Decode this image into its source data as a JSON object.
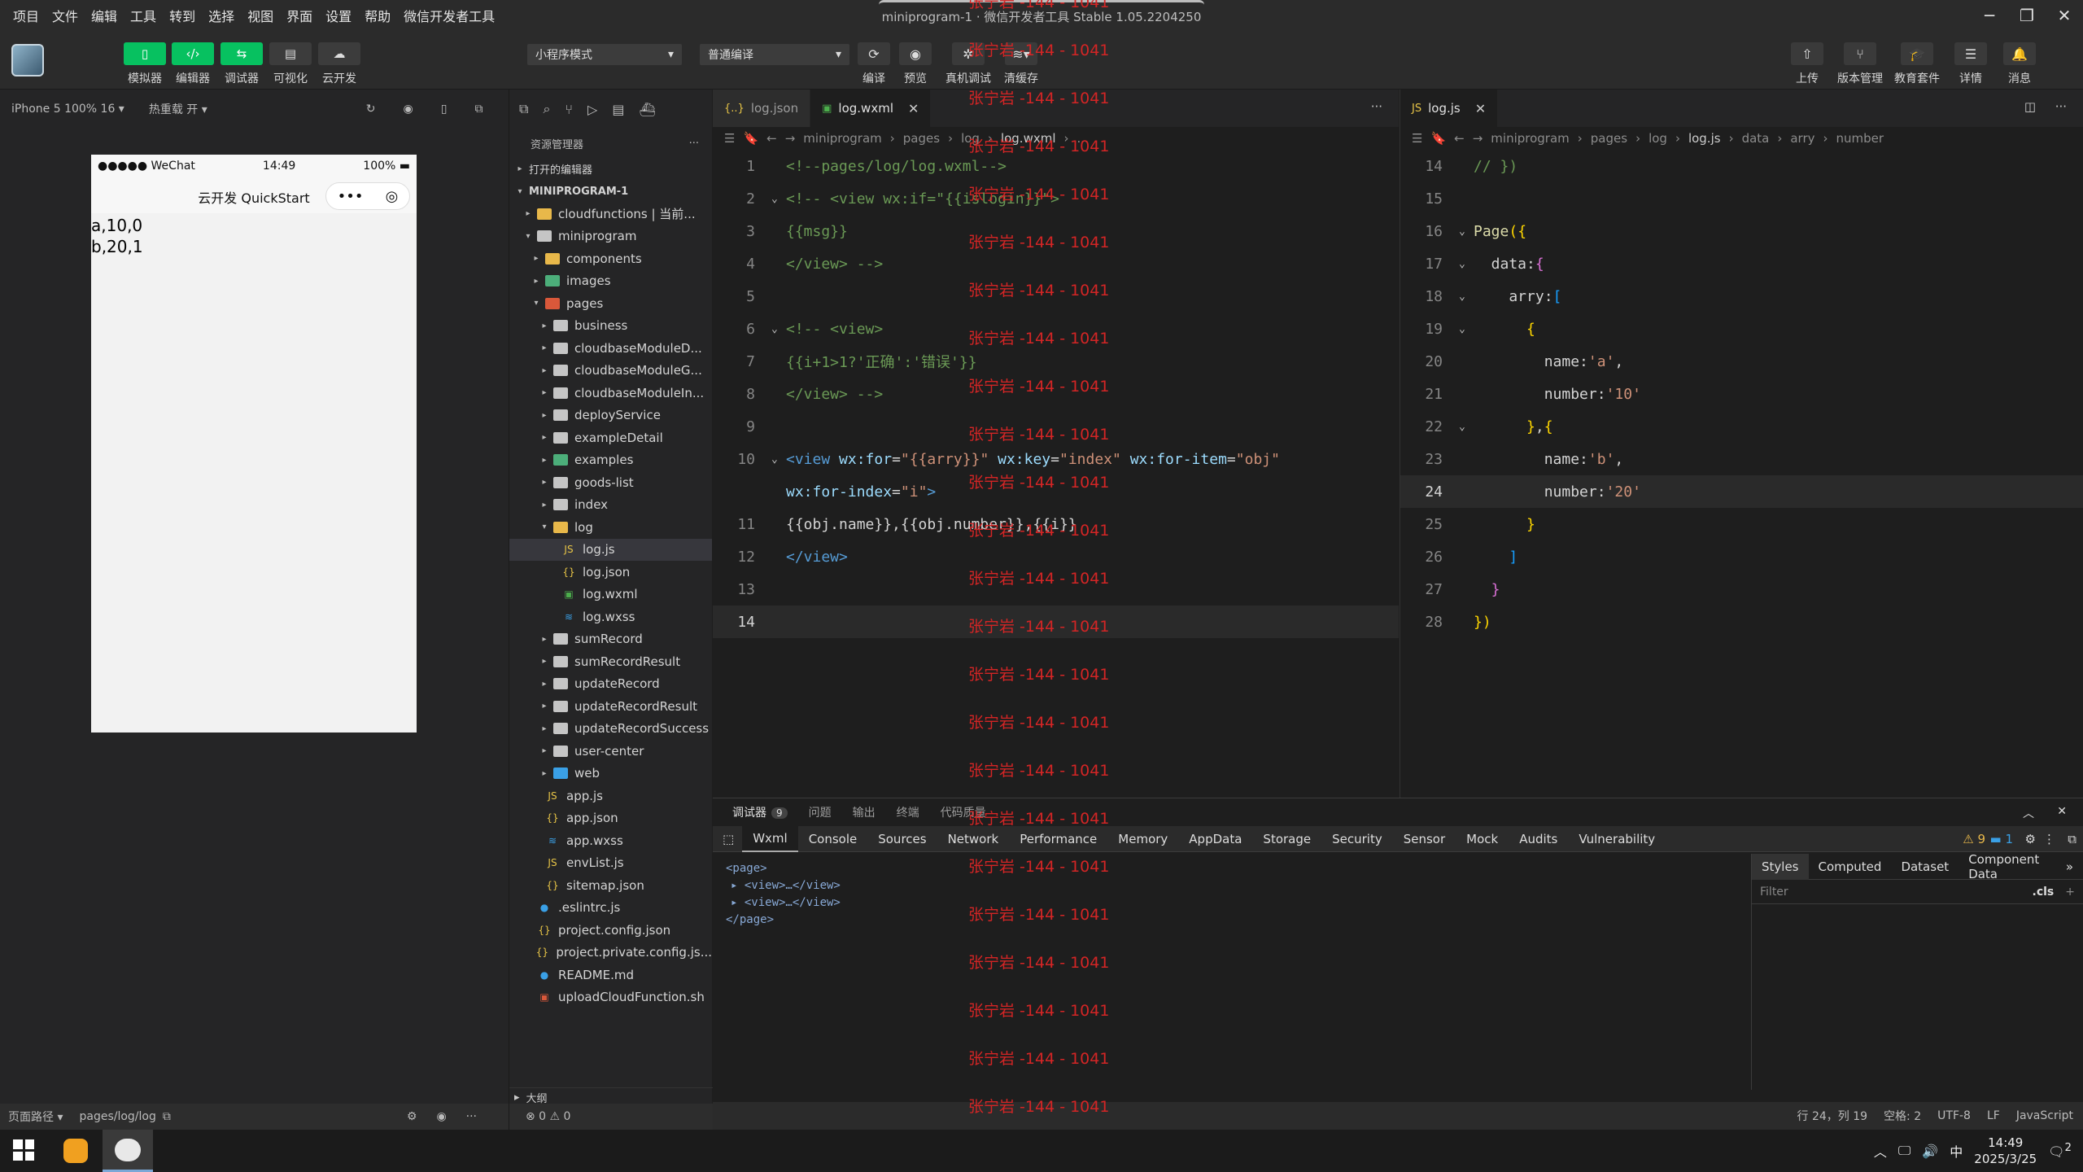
{
  "menu": [
    "项目",
    "文件",
    "编辑",
    "工具",
    "转到",
    "选择",
    "视图",
    "界面",
    "设置",
    "帮助",
    "微信开发者工具"
  ],
  "window_title": "miniprogram-1 · 微信开发者工具 Stable 1.05.2204250",
  "toolbar": {
    "left_buttons": [
      "模拟器",
      "编辑器",
      "调试器",
      "可视化",
      "云开发"
    ],
    "mode_select": "小程序模式",
    "compile_select": "普通编译",
    "center_buttons": [
      "编译",
      "预览",
      "真机调试",
      "清缓存"
    ],
    "right_buttons": [
      "上传",
      "版本管理",
      "教育套件",
      "详情",
      "消息"
    ]
  },
  "simulator": {
    "device": "iPhone 5 100% 16 ▾",
    "hot_reload": "热重载 开 ▾",
    "status_carrier": "●●●●● WeChat",
    "status_time": "14:49",
    "status_battery": "100%",
    "nav_title": "云开发 QuickStart",
    "capsule_dots": "•••",
    "body_lines": [
      "a,10,0",
      "b,20,1"
    ],
    "footer_path_label": "页面路径 ▾",
    "footer_path": "pages/log/log"
  },
  "explorer": {
    "title": "资源管理器",
    "more": "···",
    "open_editors": "打开的编辑器",
    "project": "MINIPROGRAM-1",
    "outline": "大纲",
    "status": "⊗ 0 ⚠ 0",
    "tree": [
      {
        "depth": 1,
        "arrow": "▸",
        "icon": "folder-y",
        "label": "cloudfunctions | 当前..."
      },
      {
        "depth": 1,
        "arrow": "▾",
        "icon": "folder",
        "label": "miniprogram"
      },
      {
        "depth": 2,
        "arrow": "▸",
        "icon": "folder-y",
        "label": "components"
      },
      {
        "depth": 2,
        "arrow": "▸",
        "icon": "folder-g",
        "label": "images"
      },
      {
        "depth": 2,
        "arrow": "▾",
        "icon": "folder-r",
        "label": "pages"
      },
      {
        "depth": 3,
        "arrow": "▸",
        "icon": "folder",
        "label": "business"
      },
      {
        "depth": 3,
        "arrow": "▸",
        "icon": "folder",
        "label": "cloudbaseModuleD..."
      },
      {
        "depth": 3,
        "arrow": "▸",
        "icon": "folder",
        "label": "cloudbaseModuleG..."
      },
      {
        "depth": 3,
        "arrow": "▸",
        "icon": "folder",
        "label": "cloudbaseModuleIn..."
      },
      {
        "depth": 3,
        "arrow": "▸",
        "icon": "folder",
        "label": "deployService"
      },
      {
        "depth": 3,
        "arrow": "▸",
        "icon": "folder",
        "label": "exampleDetail"
      },
      {
        "depth": 3,
        "arrow": "▸",
        "icon": "folder-g",
        "label": "examples"
      },
      {
        "depth": 3,
        "arrow": "▸",
        "icon": "folder",
        "label": "goods-list"
      },
      {
        "depth": 3,
        "arrow": "▸",
        "icon": "folder",
        "label": "index"
      },
      {
        "depth": 3,
        "arrow": "▾",
        "icon": "folder-y",
        "label": "log"
      },
      {
        "depth": 4,
        "arrow": "",
        "icon": "js",
        "label": "log.js",
        "selected": true
      },
      {
        "depth": 4,
        "arrow": "",
        "icon": "json",
        "label": "log.json"
      },
      {
        "depth": 4,
        "arrow": "",
        "icon": "wxml",
        "label": "log.wxml"
      },
      {
        "depth": 4,
        "arrow": "",
        "icon": "wxss",
        "label": "log.wxss"
      },
      {
        "depth": 3,
        "arrow": "▸",
        "icon": "folder",
        "label": "sumRecord"
      },
      {
        "depth": 3,
        "arrow": "▸",
        "icon": "folder",
        "label": "sumRecordResult"
      },
      {
        "depth": 3,
        "arrow": "▸",
        "icon": "folder",
        "label": "updateRecord"
      },
      {
        "depth": 3,
        "arrow": "▸",
        "icon": "folder",
        "label": "updateRecordResult"
      },
      {
        "depth": 3,
        "arrow": "▸",
        "icon": "folder",
        "label": "updateRecordSuccess"
      },
      {
        "depth": 3,
        "arrow": "▸",
        "icon": "folder",
        "label": "user-center"
      },
      {
        "depth": 3,
        "arrow": "▸",
        "icon": "folder-b",
        "label": "web"
      },
      {
        "depth": 2,
        "arrow": "",
        "icon": "js",
        "label": "app.js"
      },
      {
        "depth": 2,
        "arrow": "",
        "icon": "json",
        "label": "app.json"
      },
      {
        "depth": 2,
        "arrow": "",
        "icon": "wxss",
        "label": "app.wxss"
      },
      {
        "depth": 2,
        "arrow": "",
        "icon": "js",
        "label": "envList.js"
      },
      {
        "depth": 2,
        "arrow": "",
        "icon": "json",
        "label": "sitemap.json"
      },
      {
        "depth": 1,
        "arrow": "",
        "icon": "info",
        "label": ".eslintrc.js"
      },
      {
        "depth": 1,
        "arrow": "",
        "icon": "json",
        "label": "project.config.json"
      },
      {
        "depth": 1,
        "arrow": "",
        "icon": "json",
        "label": "project.private.config.js..."
      },
      {
        "depth": 1,
        "arrow": "",
        "icon": "info",
        "label": "README.md"
      },
      {
        "depth": 1,
        "arrow": "",
        "icon": "sh",
        "label": "uploadCloudFunction.sh"
      }
    ]
  },
  "editor_left": {
    "tabs": [
      {
        "icon": "{..}",
        "label": "log.json",
        "active": false
      },
      {
        "icon": "▣",
        "label": "log.wxml",
        "active": true
      }
    ],
    "breadcrumb": [
      "miniprogram",
      "pages",
      "log",
      "log.wxml",
      "..."
    ],
    "lines": [
      {
        "n": "1",
        "fold": "",
        "segs": [
          [
            "c-comment",
            "<!--pages/log/log.wxml-->"
          ]
        ]
      },
      {
        "n": "2",
        "fold": "⌄",
        "segs": [
          [
            "c-comment",
            "<!-- <view wx:if=\"{{islogin}}\">"
          ]
        ]
      },
      {
        "n": "3",
        "fold": "",
        "segs": [
          [
            "c-comment",
            "{{msg}}"
          ]
        ]
      },
      {
        "n": "4",
        "fold": "",
        "segs": [
          [
            "c-comment",
            "</view> -->"
          ]
        ]
      },
      {
        "n": "5",
        "fold": "",
        "segs": []
      },
      {
        "n": "6",
        "fold": "⌄",
        "segs": [
          [
            "c-comment",
            "<!-- <view>"
          ]
        ]
      },
      {
        "n": "7",
        "fold": "",
        "segs": [
          [
            "c-comment",
            "{{i+1>1?'正确':'错误'}}"
          ]
        ]
      },
      {
        "n": "8",
        "fold": "",
        "segs": [
          [
            "c-comment",
            "</view> -->"
          ]
        ]
      },
      {
        "n": "9",
        "fold": "",
        "segs": []
      },
      {
        "n": "10",
        "fold": "⌄",
        "segs": [
          [
            "c-tag",
            "<view "
          ],
          [
            "c-attr",
            "wx:for"
          ],
          [
            "c-text",
            "="
          ],
          [
            "c-str",
            "\"{{arry}}\""
          ],
          [
            "c-text",
            " "
          ],
          [
            "c-attr",
            "wx:key"
          ],
          [
            "c-text",
            "="
          ],
          [
            "c-str",
            "\"index\""
          ],
          [
            "c-text",
            " "
          ],
          [
            "c-attr",
            "wx:for-item"
          ],
          [
            "c-text",
            "="
          ],
          [
            "c-str",
            "\"obj\""
          ]
        ]
      },
      {
        "n": "",
        "fold": "",
        "segs": [
          [
            "c-attr",
            "wx:for-index"
          ],
          [
            "c-text",
            "="
          ],
          [
            "c-str",
            "\"i\""
          ],
          [
            "c-tag",
            ">"
          ]
        ]
      },
      {
        "n": "11",
        "fold": "",
        "segs": [
          [
            "c-text",
            "{{obj.name}},{{obj.number}},{{i}}"
          ]
        ]
      },
      {
        "n": "12",
        "fold": "",
        "segs": [
          [
            "c-tag",
            "</view>"
          ]
        ]
      },
      {
        "n": "13",
        "fold": "",
        "segs": []
      },
      {
        "n": "14",
        "fold": "",
        "segs": [],
        "current": true
      }
    ]
  },
  "editor_right": {
    "tabs": [
      {
        "icon": "JS",
        "label": "log.js",
        "active": true
      }
    ],
    "breadcrumb": [
      "miniprogram",
      "pages",
      "log",
      "log.js",
      "data",
      "arry",
      "number"
    ],
    "lines": [
      {
        "n": "14",
        "fold": "",
        "segs": [
          [
            "c-comment",
            "// })"
          ]
        ]
      },
      {
        "n": "15",
        "fold": "",
        "segs": []
      },
      {
        "n": "16",
        "fold": "⌄",
        "segs": [
          [
            "c-kw",
            "Page"
          ],
          [
            "c-brace",
            "({"
          ]
        ]
      },
      {
        "n": "17",
        "fold": "⌄",
        "segs": [
          [
            "c-text",
            "  data:"
          ],
          [
            "c-brace2",
            "{"
          ]
        ]
      },
      {
        "n": "18",
        "fold": "⌄",
        "segs": [
          [
            "c-text",
            "    arry:"
          ],
          [
            "c-brace3",
            "["
          ]
        ]
      },
      {
        "n": "19",
        "fold": "⌄",
        "segs": [
          [
            "c-brace",
            "      {"
          ]
        ]
      },
      {
        "n": "20",
        "fold": "",
        "segs": [
          [
            "c-text",
            "        name:"
          ],
          [
            "c-str",
            "'a'"
          ],
          [
            "c-text",
            ","
          ]
        ]
      },
      {
        "n": "21",
        "fold": "",
        "segs": [
          [
            "c-text",
            "        number:"
          ],
          [
            "c-str",
            "'10'"
          ]
        ]
      },
      {
        "n": "22",
        "fold": "⌄",
        "segs": [
          [
            "c-brace",
            "      }"
          ],
          [
            "c-text",
            ","
          ],
          [
            "c-brace",
            "{"
          ]
        ]
      },
      {
        "n": "23",
        "fold": "",
        "segs": [
          [
            "c-text",
            "        name:"
          ],
          [
            "c-str",
            "'b'"
          ],
          [
            "c-text",
            ","
          ]
        ]
      },
      {
        "n": "24",
        "fold": "",
        "segs": [
          [
            "c-text",
            "        number:"
          ],
          [
            "c-str",
            "'20'"
          ]
        ],
        "current": true
      },
      {
        "n": "25",
        "fold": "",
        "segs": [
          [
            "c-brace",
            "      }"
          ]
        ]
      },
      {
        "n": "26",
        "fold": "",
        "segs": [
          [
            "c-brace3",
            "    ]"
          ]
        ]
      },
      {
        "n": "27",
        "fold": "",
        "segs": [
          [
            "c-brace2",
            "  }"
          ]
        ]
      },
      {
        "n": "28",
        "fold": "",
        "segs": [
          [
            "c-brace",
            "})"
          ]
        ]
      }
    ]
  },
  "watermark": "张宁岩 -144 - 1041",
  "debugger": {
    "panel_tabs": [
      "调试器",
      "问题",
      "输出",
      "终端",
      "代码质量"
    ],
    "debug_badge": "9",
    "devtools_tabs": [
      "Wxml",
      "Console",
      "Sources",
      "Network",
      "Performance",
      "Memory",
      "AppData",
      "Storage",
      "Security",
      "Sensor",
      "Mock",
      "Audits",
      "Vulnerability"
    ],
    "warn_count": "⚠ 9",
    "info_count": "▬ 1",
    "wxml_tree": [
      "<page>",
      "▸ <view>…</view>",
      "▸ <view>…</view>",
      "</page>"
    ],
    "styles_tabs": [
      "Styles",
      "Computed",
      "Dataset",
      "Component Data"
    ],
    "filter_placeholder": "Filter",
    "cls": ".cls"
  },
  "statusbar": [
    "行 24，列 19",
    "空格: 2",
    "UTF-8",
    "LF",
    "JavaScript"
  ],
  "taskbar": {
    "time": "14:49",
    "date": "2025/3/25",
    "ime": "中",
    "notifications": "2"
  }
}
